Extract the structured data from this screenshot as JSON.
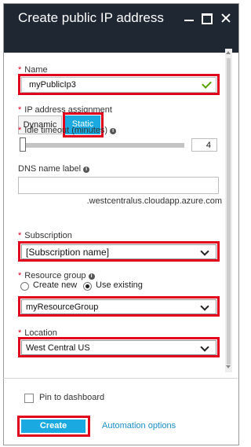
{
  "window": {
    "title": "Create public IP address"
  },
  "form": {
    "name": {
      "label": "Name",
      "value": "myPublicIp3",
      "required": true
    },
    "ip_assignment": {
      "label": "IP address assignment",
      "options": [
        "Dynamic",
        "Static"
      ],
      "selected": "Static",
      "required": true
    },
    "idle_timeout": {
      "label": "Idle timeout (minutes)",
      "value": "4",
      "required": true
    },
    "dns_label": {
      "label": "DNS name label",
      "value": "",
      "suffix": ".westcentralus.cloudapp.azure.com"
    },
    "subscription": {
      "label": "Subscription",
      "value": "[Subscription name]",
      "required": true
    },
    "resource_group": {
      "label": "Resource group",
      "options": [
        "Create new",
        "Use existing"
      ],
      "selected": "Use existing",
      "value": "myResourceGroup",
      "required": true
    },
    "location": {
      "label": "Location",
      "value": "West Central US",
      "required": true
    }
  },
  "footer": {
    "pin_label": "Pin to dashboard",
    "pin_checked": false,
    "create_label": "Create",
    "automation_label": "Automation options"
  },
  "colors": {
    "title_bar": "#1f2733",
    "accent": "#1aa9e0",
    "highlight_box": "#e0001c",
    "required_star": "#e0001c",
    "link": "#1a8ec9",
    "valid_check": "#57a300"
  },
  "icons": [
    "minimize-icon",
    "maximize-icon",
    "close-icon",
    "checkmark-icon",
    "info-icon",
    "chevron-down-icon"
  ]
}
